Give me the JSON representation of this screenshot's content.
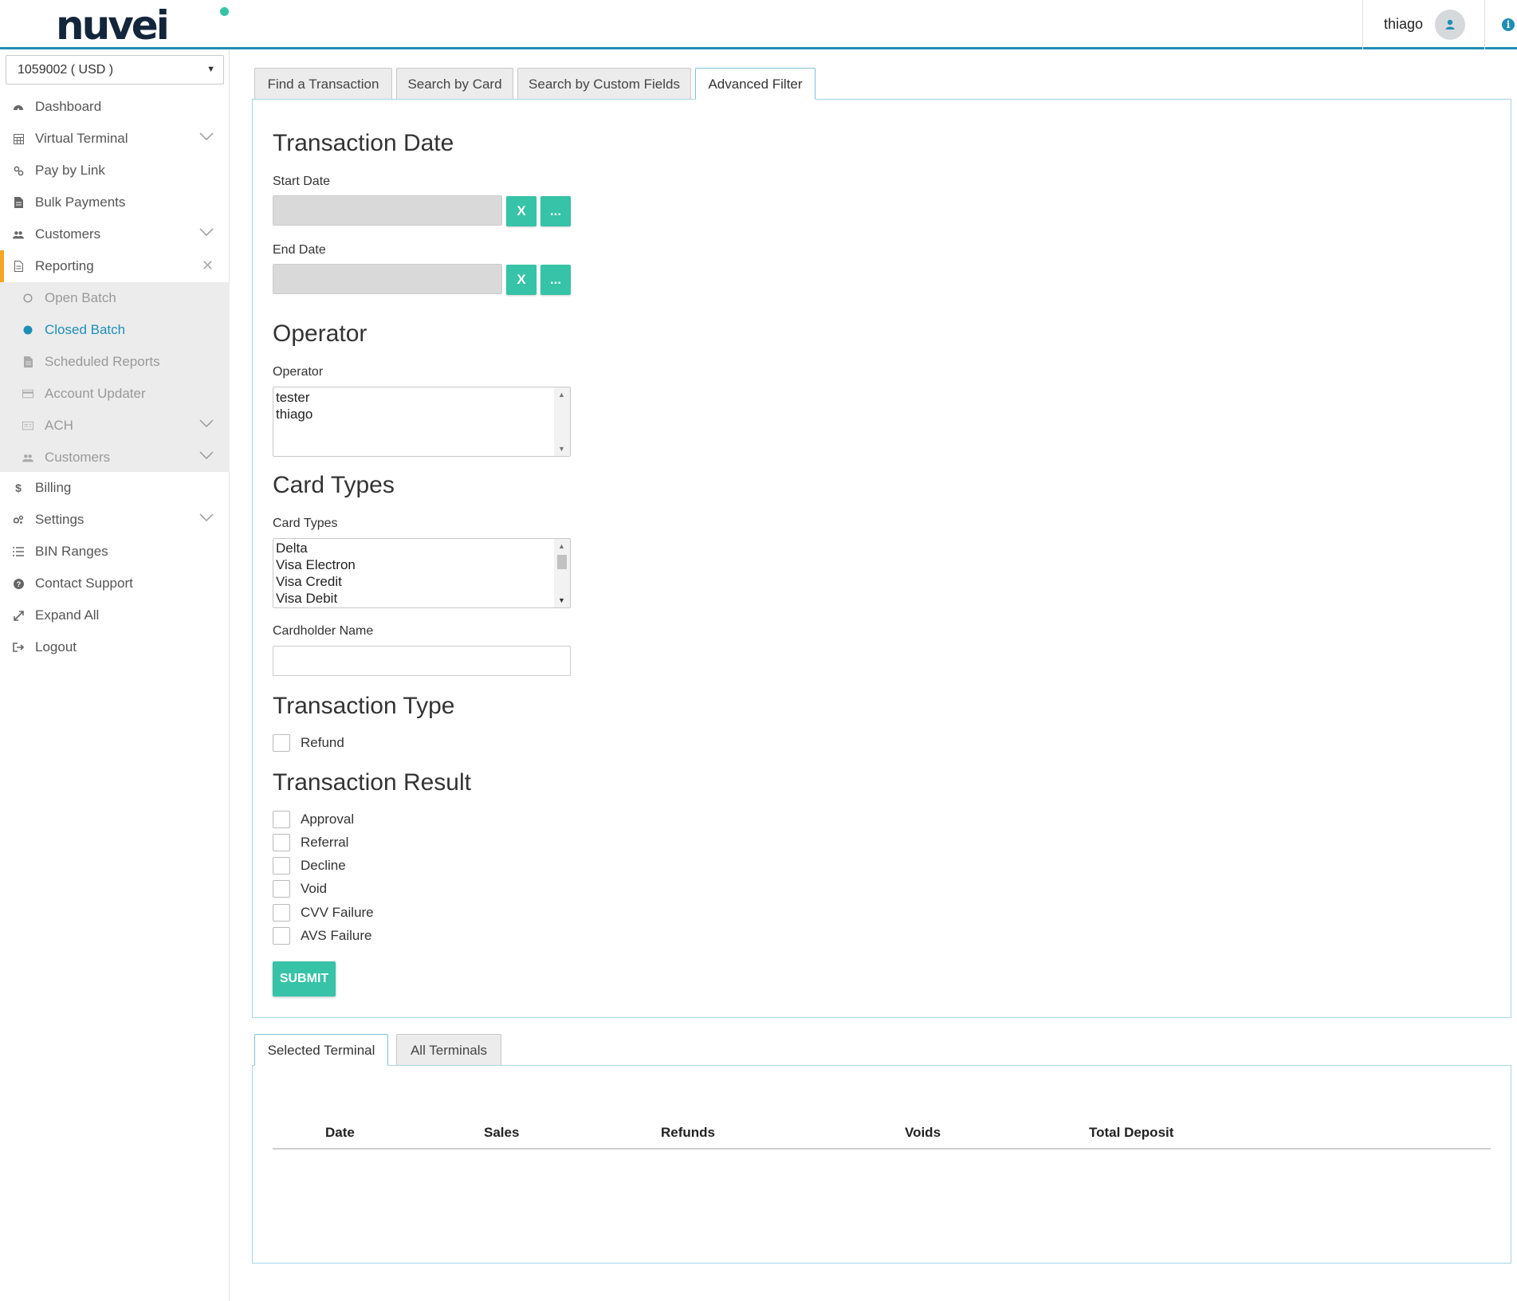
{
  "header": {
    "logo_text": "nuvei",
    "user_name": "thiago",
    "info_icon": "info-icon",
    "avatar_icon": "user-icon"
  },
  "sidebar": {
    "account_select": "1059002 ( USD )",
    "items": [
      {
        "label": "Dashboard",
        "icon": "dashboard-icon"
      },
      {
        "label": "Virtual Terminal",
        "icon": "calculator-icon"
      },
      {
        "label": "Pay by Link",
        "icon": "link-icon"
      },
      {
        "label": "Bulk Payments",
        "icon": "file-icon"
      },
      {
        "label": "Customers",
        "icon": "users-icon"
      },
      {
        "label": "Reporting",
        "icon": "report-icon"
      }
    ],
    "reporting_submenu": [
      {
        "label": "Open Batch",
        "icon": "circle-outline-icon"
      },
      {
        "label": "Closed Batch",
        "icon": "circle-filled-icon"
      },
      {
        "label": "Scheduled Reports",
        "icon": "file-icon"
      },
      {
        "label": "Account Updater",
        "icon": "credit-card-icon"
      },
      {
        "label": "ACH",
        "icon": "ach-icon"
      },
      {
        "label": "Customers",
        "icon": "users-icon"
      }
    ],
    "items_after": [
      {
        "label": "Billing",
        "icon": "dollar-icon"
      },
      {
        "label": "Settings",
        "icon": "cogs-icon"
      },
      {
        "label": "BIN Ranges",
        "icon": "list-icon"
      },
      {
        "label": "Contact Support",
        "icon": "question-icon"
      },
      {
        "label": "Expand All",
        "icon": "expand-icon"
      },
      {
        "label": "Logout",
        "icon": "logout-icon"
      }
    ]
  },
  "search_tabs": [
    "Find a Transaction",
    "Search by Card",
    "Search by Custom Fields",
    "Advanced Filter"
  ],
  "filter": {
    "transaction_date_heading": "Transaction Date",
    "start_date_label": "Start Date",
    "end_date_label": "End Date",
    "clear_label": "X",
    "picker_label": "...",
    "operator_heading": "Operator",
    "operator_label": "Operator",
    "operators": [
      "tester",
      "thiago"
    ],
    "card_types_heading": "Card Types",
    "card_types_label": "Card Types",
    "card_types": [
      "Delta",
      "Visa Electron",
      "Visa Credit",
      "Visa Debit"
    ],
    "cardholder_label": "Cardholder Name",
    "transaction_type_heading": "Transaction Type",
    "transaction_types": [
      "Refund"
    ],
    "transaction_result_heading": "Transaction Result",
    "transaction_results": [
      "Approval",
      "Referral",
      "Decline",
      "Void",
      "CVV Failure",
      "AVS Failure"
    ],
    "submit_label": "SUBMIT"
  },
  "terminal_tabs": [
    "Selected Terminal",
    "All Terminals"
  ],
  "summary_table": {
    "columns": [
      "Date",
      "Sales",
      "Refunds",
      "Voids",
      "Total Deposit"
    ]
  },
  "colors": {
    "accent": "#36c3a7",
    "brand_blue": "#1f8eb5",
    "active_marker": "#f5a623"
  }
}
